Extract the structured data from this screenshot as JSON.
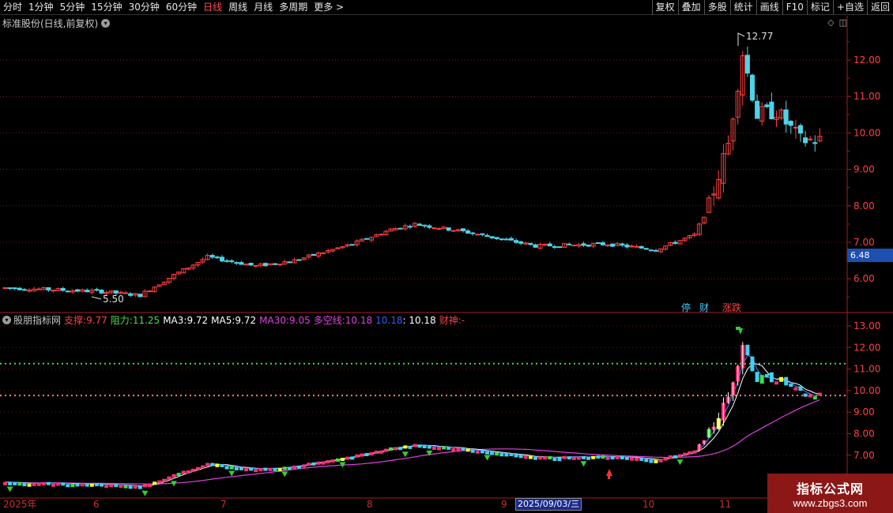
{
  "toolbar": {
    "periods": [
      "分时",
      "1分钟",
      "5分钟",
      "15分钟",
      "30分钟",
      "60分钟",
      "日线",
      "周线",
      "月线",
      "多周期",
      "更多 >"
    ],
    "active_period": "日线",
    "right_buttons": [
      "复权",
      "叠加",
      "多股",
      "统计",
      "画线",
      "F10",
      "标记",
      "+自选",
      "返回"
    ]
  },
  "main_chart": {
    "stock_label": "标准股份(日线,前复权)",
    "high_mark": "12.77",
    "low_mark": "5.50",
    "y_ticks": [
      "12.00",
      "11.00",
      "10.00",
      "9.00",
      "8.00",
      "7.00",
      "6.00"
    ],
    "current_price": "6.48",
    "badges": [
      "停",
      "财",
      "涨跌"
    ]
  },
  "indicator": {
    "name": "股朋指标网",
    "support_label": "支撑:",
    "support_value": "9.77",
    "resist_label": "阻力:",
    "resist_value": "11.25",
    "ma3_label": "MA3:",
    "ma3_value": "9.72",
    "ma5_label": "MA5:",
    "ma5_value": "9.72",
    "ma30_label": "MA30:",
    "ma30_value": "9.05",
    "dk_label": "多空线:",
    "dk_value": "10.18",
    "blue_value": "10.18",
    "white_value": ": 10.18",
    "caishen_label": "财神:",
    "caishen_value": "-",
    "y_ticks": [
      "13.00",
      "12.00",
      "11.00",
      "10.00",
      "9.00",
      "8.00",
      "7.00"
    ]
  },
  "x_axis": {
    "labels": [
      "2025年",
      "6",
      "7",
      "8",
      "9",
      "10",
      "11"
    ],
    "selected_date": "2025/09/03/三"
  },
  "watermark": {
    "line1": "指标公式网",
    "line2": "www.zbgs3.com"
  },
  "colors": {
    "up": "#ff4040",
    "down": "#4cd4e8",
    "ma30": "#e040e0",
    "support_line": "#ff8080",
    "resist_line": "#40e040"
  }
}
